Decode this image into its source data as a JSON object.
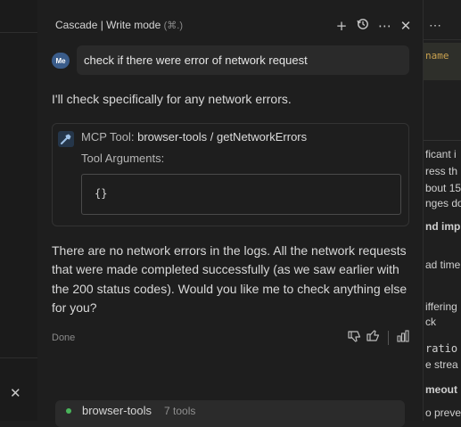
{
  "header": {
    "title": "Cascade | Write mode",
    "shortcut": "(⌘.)",
    "icons": [
      "plus-icon",
      "history-icon",
      "more-icon",
      "close-icon"
    ]
  },
  "user": {
    "avatar": "Me",
    "message": "check if there were error of network request"
  },
  "assistant": {
    "intro": "I'll check specifically for any network errors.",
    "tool": {
      "prefix": "MCP Tool:",
      "name": "browser-tools / getNetworkErrors",
      "args_label": "Tool Arguments:",
      "args_value": "{}"
    },
    "response": "There are no network errors in the logs. All the network requests that were made completed successfully (as we saw earlier with the 200 status codes). Would you like me to check anything else for you?",
    "status": "Done"
  },
  "mcp": {
    "server": "browser-tools",
    "count": "7 tools",
    "status_color": "#4ab55b"
  },
  "right_peek": {
    "code": "name",
    "lines": [
      "ficant i",
      "ress th",
      "bout 15",
      "nges do",
      "nd imp",
      "ad time",
      "iffering",
      "ck",
      "ratio",
      "e strea",
      "meout",
      "o preve"
    ]
  },
  "colors": {
    "background": "#1f1f1f",
    "panel": "#1e1e1e",
    "user_bubble": "#2a2a2a",
    "avatar": "#3a5c8a"
  }
}
